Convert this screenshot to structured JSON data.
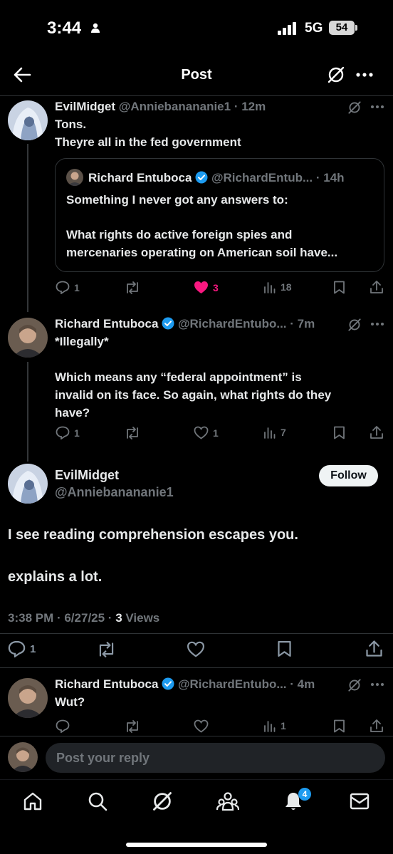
{
  "status_bar": {
    "time": "3:44",
    "network": "5G",
    "battery": "54"
  },
  "header": {
    "title": "Post"
  },
  "tweets": [
    {
      "name": "EvilMidget",
      "handle": "@Anniebanananie1",
      "time": "· 12m",
      "text_lines": [
        "Tons.",
        "Theyre all in the fed government"
      ],
      "quote": {
        "name": "Richard Entuboca",
        "handle": "@RichardEntub...",
        "time": "· 14h",
        "line1": "Something I never got any answers to:",
        "line2": "What rights do active foreign spies and",
        "line3": "mercenaries operating on American soil have..."
      },
      "replies": "1",
      "likes": "3",
      "views": "18"
    },
    {
      "name": "Richard Entuboca",
      "handle": "@RichardEntubo...",
      "time": "· 7m",
      "text_lines": [
        "*Illegally*",
        "Which means any “federal appointment” is",
        "invalid on its face. So again, what rights do they",
        "have?"
      ],
      "replies": "1",
      "likes": "1",
      "views": "7"
    }
  ],
  "main_post": {
    "name": "EvilMidget",
    "handle": "@Anniebanananie1",
    "follow_label": "Follow",
    "line1": "I see reading comprehension escapes you.",
    "line2": "explains a lot.",
    "meta_time": "3:38 PM · 6/27/25 · ",
    "views_count": "3",
    "views_label": " Views",
    "replies": "1"
  },
  "reply_tweet": {
    "name": "Richard Entuboca",
    "handle": "@RichardEntubo...",
    "time": "· 4m",
    "text": "Wut?",
    "views": "1"
  },
  "reply_box": {
    "placeholder": "Post your reply"
  },
  "bottom_nav": {
    "notifications_badge": "4"
  },
  "colors": {
    "accent": "#1d9bf0",
    "like": "#f91880",
    "verified": "#1d9bf0"
  }
}
